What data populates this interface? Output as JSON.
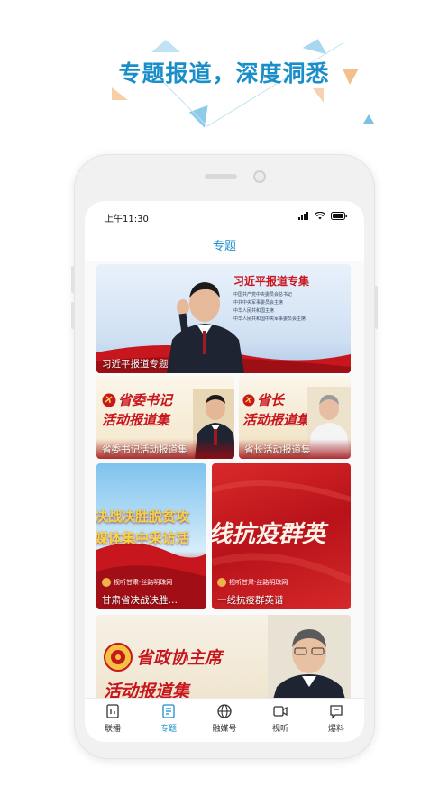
{
  "headline": "专题报道，深度洞悉",
  "status_bar": {
    "time": "上午11:30"
  },
  "nav": {
    "title": "专题"
  },
  "cards": {
    "xi": {
      "caption": "习近平报道专题",
      "banner_title": "习近平报道专集",
      "banner_lines": [
        "中国共产党中央委员会总书记",
        "中共中央军事委员会主席",
        "中华人民共和国主席",
        "中华人民共和国中央军事委员会主席"
      ]
    },
    "secretary": {
      "caption": "省委书记活动报道集",
      "overlay_line1": "省委书记",
      "overlay_line2": "活动报道集"
    },
    "governor": {
      "caption": "省长活动报道集",
      "overlay_line1": "省长",
      "overlay_line2": "活动报道集"
    },
    "poverty": {
      "caption": "甘肃省决战决胜…",
      "overlay_line1": "决战决胜脱贫攻",
      "overlay_line2": "媒体集中采访活",
      "source": "视听甘肃·丝路明珠网"
    },
    "epidemic": {
      "caption": "一线抗疫群英谱",
      "overlay_text": "线抗疫群英",
      "source": "视听甘肃·丝路明珠网"
    },
    "cppcc": {
      "overlay_line1": "省政协主席",
      "overlay_line2": "活动报道集"
    }
  },
  "tabbar": {
    "items": [
      {
        "label": "联播",
        "icon": "broadcast-icon"
      },
      {
        "label": "专题",
        "icon": "topic-icon"
      },
      {
        "label": "融媒号",
        "icon": "globe-icon"
      },
      {
        "label": "视听",
        "icon": "video-icon"
      },
      {
        "label": "爆料",
        "icon": "tipoff-icon"
      }
    ]
  },
  "colors": {
    "accent": "#1a8ec9",
    "red": "#c8161e",
    "gold": "#f7d44a"
  }
}
